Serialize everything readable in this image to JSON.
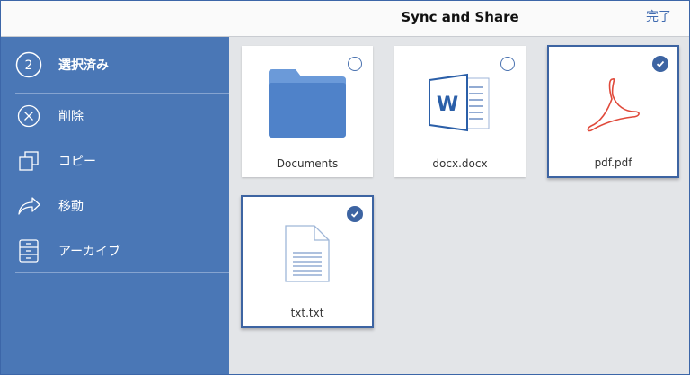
{
  "navbar": {
    "title": "Sync and Share",
    "done_label": "完了"
  },
  "sidebar": {
    "selected_count": "2",
    "selected_label": "選択済み",
    "actions": [
      {
        "icon": "close-circle-icon",
        "label": "削除"
      },
      {
        "icon": "copy-icon",
        "label": "コピー"
      },
      {
        "icon": "move-arrow-icon",
        "label": "移動"
      },
      {
        "icon": "archive-icon",
        "label": "アーカイブ"
      }
    ]
  },
  "files": [
    {
      "name": "Documents",
      "type": "folder",
      "icon": "folder-icon",
      "selected": false
    },
    {
      "name": "docx.docx",
      "type": "word",
      "icon": "word-document-icon",
      "selected": false
    },
    {
      "name": "pdf.pdf",
      "type": "pdf",
      "icon": "pdf-icon",
      "selected": true
    },
    {
      "name": "txt.txt",
      "type": "text",
      "icon": "text-file-icon",
      "selected": true
    }
  ],
  "colors": {
    "accent": "#3f6ab0",
    "sidebar": "#4a77b6",
    "content_bg": "#e3e5e8",
    "folder": "#4f82c9",
    "word": "#2b5fa8",
    "pdf": "#e0493a"
  }
}
